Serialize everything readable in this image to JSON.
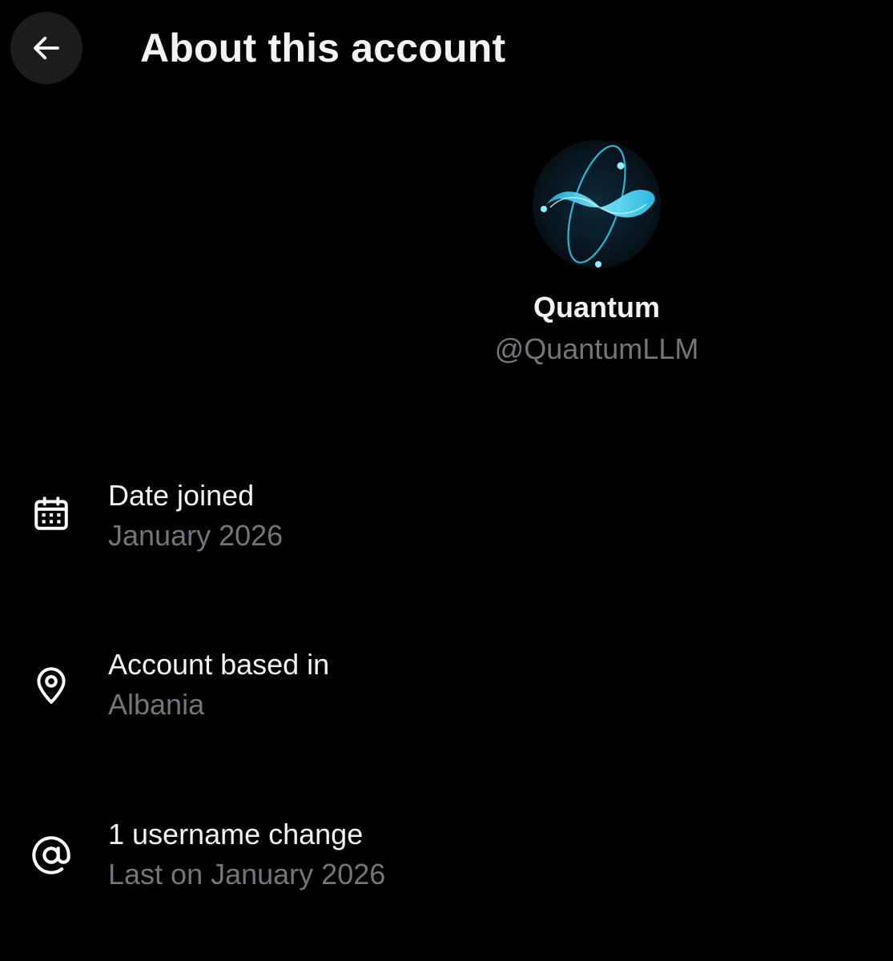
{
  "header": {
    "title": "About this account",
    "back_icon": "arrow-left-icon"
  },
  "profile": {
    "avatar_icon": "quantum-infinity-logo",
    "display_name": "Quantum",
    "handle": "@QuantumLLM"
  },
  "info": [
    {
      "icon": "calendar-icon",
      "label": "Date joined",
      "value": "January 2026"
    },
    {
      "icon": "location-pin-icon",
      "label": "Account based in",
      "value": "Albania"
    },
    {
      "icon": "at-sign-icon",
      "label": "1 username change",
      "value": "Last on January 2026"
    }
  ],
  "colors": {
    "background": "#000000",
    "primary_text": "#f2f3f4",
    "secondary_text": "#71767b",
    "back_button_bg": "#1c1c1e",
    "logo_accent": "#2ec6ea"
  }
}
